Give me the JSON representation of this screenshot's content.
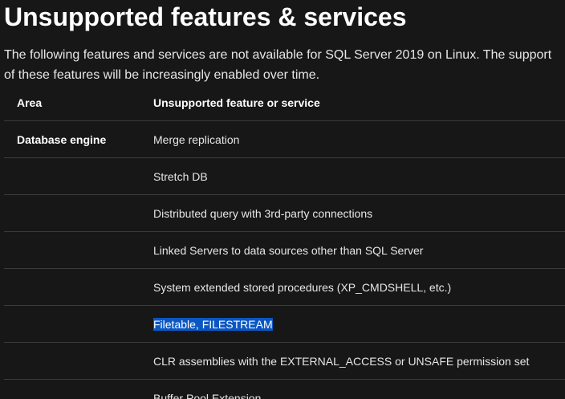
{
  "heading": "Unsupported features & services",
  "intro": "The following features and services are not available for SQL Server 2019 on Linux. The support of these features will be increasingly enabled over time.",
  "table": {
    "headers": [
      "Area",
      "Unsupported feature or service"
    ],
    "rows": [
      {
        "area": "Database engine",
        "feature": "Merge replication"
      },
      {
        "area": "",
        "feature": "Stretch DB"
      },
      {
        "area": "",
        "feature": "Distributed query with 3rd-party connections"
      },
      {
        "area": "",
        "feature": "Linked Servers to data sources other than SQL Server"
      },
      {
        "area": "",
        "feature": "System extended stored procedures (XP_CMDSHELL, etc.)"
      },
      {
        "area": "",
        "feature": "Filetable, FILESTREAM",
        "selected": true
      },
      {
        "area": "",
        "feature": "CLR assemblies with the EXTERNAL_ACCESS or UNSAFE permission set"
      },
      {
        "area": "",
        "feature": "Buffer Pool Extension"
      }
    ]
  },
  "colors": {
    "background": "#171717",
    "selection": "#0b57c2",
    "divider": "#3b3b3b"
  }
}
